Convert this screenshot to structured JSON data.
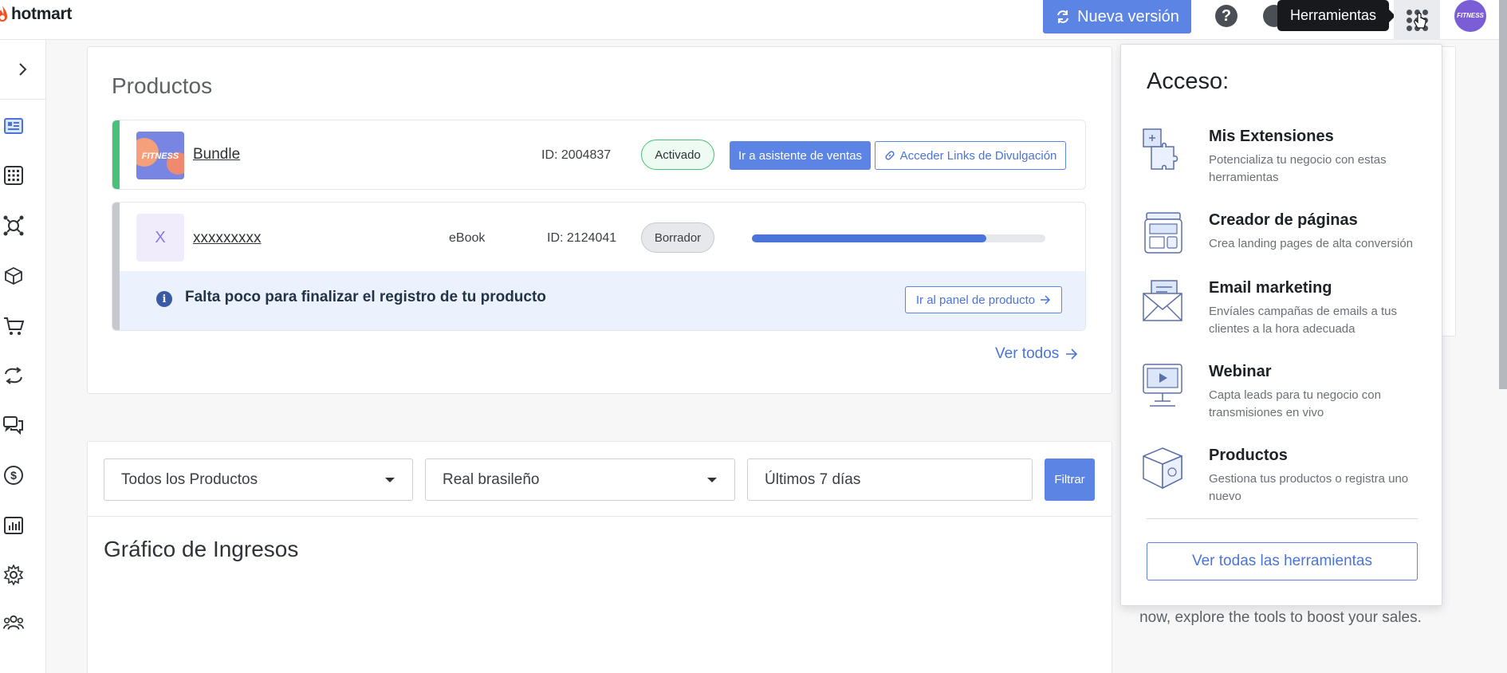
{
  "header": {
    "logo_text": "hotmart",
    "new_version_label": "Nueva versión",
    "help_label": "?",
    "tooltip": "Herramientas",
    "avatar_text": "FITNESS",
    "accent_color": "#5b84e4"
  },
  "sidebar": {
    "icons": [
      "chevron-right-icon",
      "dashboard-icon",
      "apps-icon",
      "affiliate-network-icon",
      "product-box-icon",
      "cart-icon",
      "sync-icon",
      "chat-icon",
      "money-icon",
      "chart-icon",
      "settings-icon",
      "users-icon"
    ]
  },
  "products": {
    "title": "Productos",
    "items": [
      {
        "name": "Bundle",
        "type": "",
        "id_text": "ID: 2004837",
        "status": "Activado",
        "status_color": "#47c07a",
        "thumb_text": "FITNESS",
        "sales_button": "Ir a asistente de ventas",
        "links_button": "Acceder Links de Divulgación"
      },
      {
        "name": "xxxxxxxxx",
        "type": "eBook",
        "id_text": "ID: 2124041",
        "status": "Borrador",
        "thumb_text": "X",
        "progress": 0.8,
        "notice_text": "Falta poco para finalizar el registro de tu producto",
        "notice_button": "Ir al panel de producto"
      }
    ],
    "see_all": "Ver todos"
  },
  "filters": {
    "product_select": "Todos los Productos",
    "currency_select": "Real brasileño",
    "period_input": "Últimos 7 días",
    "filter_button": "Filtrar"
  },
  "chart": {
    "title": "Gráfico de Ingresos"
  },
  "background_card": {
    "text": "now, explore the tools to boost your sales."
  },
  "tools_panel": {
    "title": "Acceso:",
    "tools": [
      {
        "name": "Mis Extensiones",
        "desc": "Potencializa tu negocio con estas herramientas",
        "icon": "puzzle-icon"
      },
      {
        "name": "Creador de páginas",
        "desc": "Crea landing pages de alta conversión",
        "icon": "page-builder-icon"
      },
      {
        "name": "Email marketing",
        "desc": "Envíales campañas de emails a tus clientes a la hora adecuada",
        "icon": "email-icon"
      },
      {
        "name": "Webinar",
        "desc": "Capta leads para tu negocio con transmisiones en vivo",
        "icon": "webinar-icon"
      },
      {
        "name": "Productos",
        "desc": "Gestiona tus productos o registra uno nuevo",
        "icon": "product-box-icon"
      }
    ],
    "see_all_button": "Ver todas las herramientas"
  }
}
